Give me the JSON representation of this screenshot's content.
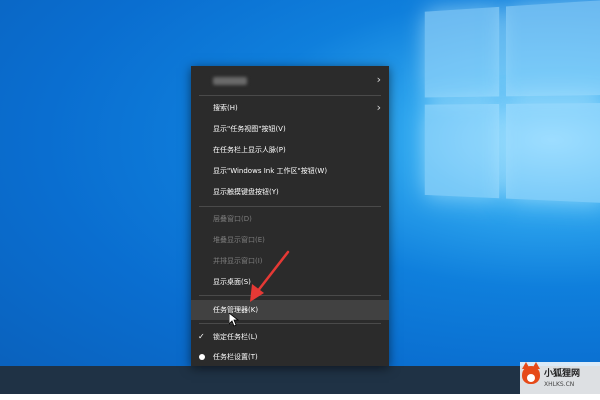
{
  "menu": {
    "items": [
      {
        "label": "",
        "blurred": true,
        "submenu": true,
        "enabled": true
      },
      {
        "label": "搜索(H)",
        "submenu": true,
        "enabled": true
      },
      {
        "label": "显示\"任务视图\"按钮(V)",
        "enabled": true
      },
      {
        "label": "在任务栏上显示人脉(P)",
        "enabled": true
      },
      {
        "label": "显示\"Windows Ink 工作区\"按钮(W)",
        "enabled": true
      },
      {
        "label": "显示触摸键盘按钮(Y)",
        "enabled": true
      },
      {
        "label": "层叠窗口(D)",
        "enabled": false
      },
      {
        "label": "堆叠显示窗口(E)",
        "enabled": false
      },
      {
        "label": "并排显示窗口(I)",
        "enabled": false
      },
      {
        "label": "显示桌面(S)",
        "enabled": true
      },
      {
        "label": "任务管理器(K)",
        "enabled": true,
        "highlighted": true
      },
      {
        "label": "锁定任务栏(L)",
        "enabled": true,
        "checked": true
      },
      {
        "label": "任务栏设置(T)",
        "enabled": true,
        "icon": "gear-icon"
      }
    ]
  },
  "watermark": {
    "brand": "小狐狸网",
    "domain": "XHLKS.CN",
    "icon": "fox-logo-icon"
  },
  "colors": {
    "menu_bg": "#2b2b2b",
    "menu_highlight": "#414141",
    "arrow_red": "#e53935",
    "desktop_blue": "#0a6ed0",
    "taskbar": "#1f3245"
  }
}
